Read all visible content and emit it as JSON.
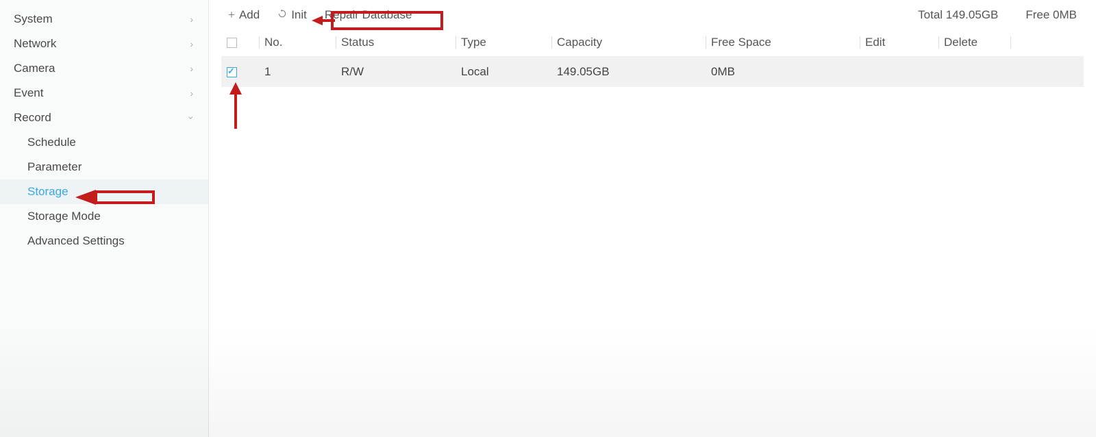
{
  "sidebar": {
    "items": [
      {
        "label": "System",
        "expandable": true,
        "expanded": false
      },
      {
        "label": "Network",
        "expandable": true,
        "expanded": false
      },
      {
        "label": "Camera",
        "expandable": true,
        "expanded": false
      },
      {
        "label": "Event",
        "expandable": true,
        "expanded": false
      },
      {
        "label": "Record",
        "expandable": true,
        "expanded": true
      }
    ],
    "record_children": [
      {
        "label": "Schedule",
        "active": false
      },
      {
        "label": "Parameter",
        "active": false
      },
      {
        "label": "Storage",
        "active": true
      },
      {
        "label": "Storage Mode",
        "active": false
      },
      {
        "label": "Advanced Settings",
        "active": false
      }
    ]
  },
  "toolbar": {
    "add_label": "Add",
    "init_label": "Init",
    "repair_label": "Repair Database"
  },
  "status": {
    "total_label": "Total 149.05GB",
    "free_label": "Free 0MB"
  },
  "table": {
    "headers": {
      "no": "No.",
      "status": "Status",
      "type": "Type",
      "capacity": "Capacity",
      "free_space": "Free Space",
      "edit": "Edit",
      "delete": "Delete"
    },
    "rows": [
      {
        "checked": true,
        "no": "1",
        "status": "R/W",
        "type": "Local",
        "capacity": "149.05GB",
        "free_space": "0MB"
      }
    ]
  }
}
